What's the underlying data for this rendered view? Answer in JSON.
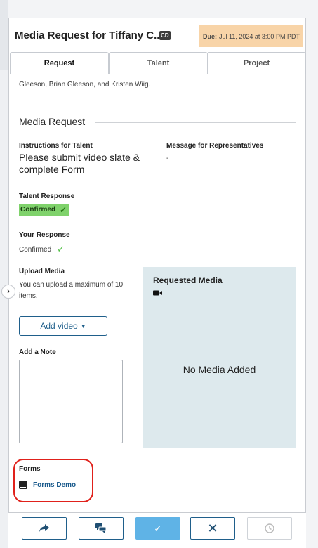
{
  "header": {
    "title": "Media Request for Tiffany C...",
    "badge": "CD",
    "due_label": "Due:",
    "due_value": "Jul 11, 2024 at 3:00 PM PDT"
  },
  "tabs": [
    {
      "label": "Request",
      "active": true
    },
    {
      "label": "Talent",
      "active": false
    },
    {
      "label": "Project",
      "active": false
    }
  ],
  "intro_text": "Gleeson, Brian Gleeson, and Kristen Wiig.",
  "section_title": "Media Request",
  "instructions": {
    "label": "Instructions for Talent",
    "value": "Please submit video slate & complete Form"
  },
  "message": {
    "label": "Message for Representatives",
    "value": "-"
  },
  "talent_response": {
    "label": "Talent Response",
    "value": "Confirmed"
  },
  "your_response": {
    "label": "Your Response",
    "value": "Confirmed"
  },
  "upload": {
    "label": "Upload Media",
    "help": "You can upload a maximum of 10 items.",
    "button": "Add video"
  },
  "requested_media": {
    "title": "Requested Media",
    "empty": "No Media Added"
  },
  "note": {
    "label": "Add a Note"
  },
  "forms": {
    "label": "Forms",
    "link": "Forms Demo"
  },
  "colors": {
    "accent": "#1f5f8b",
    "due_bg": "#f8d4a8",
    "confirmed_green": "#7fd26b",
    "media_box_bg": "#dde9ed",
    "primary_button": "#5fb3e6",
    "highlight_ring": "#e0211b"
  },
  "icons": {
    "share": "share-arrow-icon",
    "message": "chat-bubbles-icon",
    "approve": "check-icon",
    "decline": "x-icon",
    "history": "clock-icon",
    "camera": "video-camera-icon",
    "form": "form-list-icon"
  }
}
